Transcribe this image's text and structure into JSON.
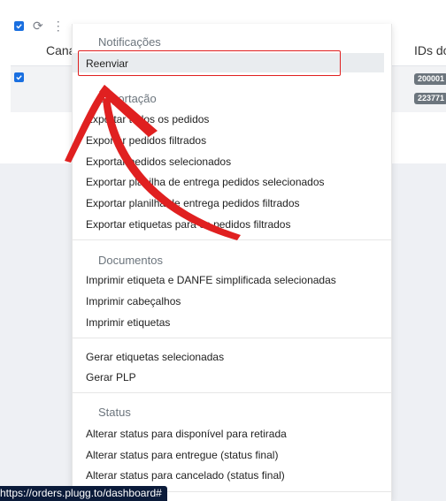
{
  "table": {
    "col_canal": "Cana",
    "col_ids": "IDs do",
    "badges": [
      "200001",
      "223771"
    ]
  },
  "menu": {
    "sections": {
      "notificacoes": "Notificações",
      "exportacao": "Exportação",
      "documentos": "Documentos",
      "status": "Status"
    },
    "reenviar": "Reenviar",
    "export_items": [
      "Exportar todos os pedidos",
      "Exportar pedidos filtrados",
      "Exportar pedidos selecionados",
      "Exportar planilha de entrega pedidos selecionados",
      "Exportar planilha de entrega pedidos filtrados",
      "Exportar etiquetas para os pedidos filtrados"
    ],
    "doc_items": [
      "Imprimir etiqueta e DANFE simplificada selecionadas",
      "Imprimir cabeçalhos",
      "Imprimir etiquetas"
    ],
    "label_items": [
      "Gerar etiquetas selecionadas",
      "Gerar PLP"
    ],
    "status_items": [
      "Alterar status para disponível para retirada",
      "Alterar status para entregue (status final)",
      "Alterar status para cancelado (status final)"
    ]
  },
  "status_bar": {
    "url": "https://orders.plugg.to/dashboard#"
  },
  "colors": {
    "annotation": "#e02020",
    "accent": "#1a6fe0"
  },
  "icons": [
    "checkbox-icon",
    "refresh-icon",
    "kebab-menu-icon"
  ]
}
